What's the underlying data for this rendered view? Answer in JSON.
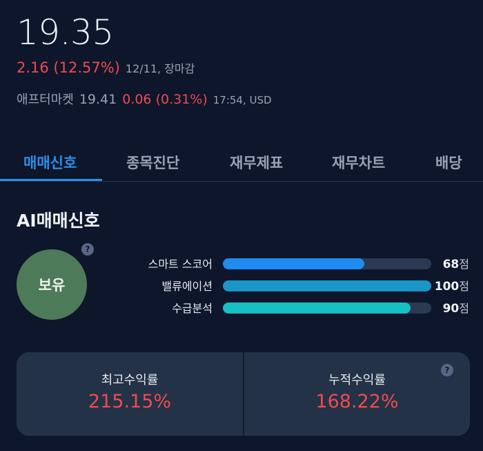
{
  "quote": {
    "price": "19.35",
    "change": "2.16 (12.57%)",
    "change_meta": "12/11, 장마감",
    "after_label": "애프터마켓",
    "after_price": "19.41",
    "after_change": "0.06 (0.31%)",
    "after_meta": "17:54, USD"
  },
  "tabs": [
    {
      "label": "매매신호",
      "active": true
    },
    {
      "label": "종목진단",
      "active": false
    },
    {
      "label": "재무제표",
      "active": false
    },
    {
      "label": "재무차트",
      "active": false
    },
    {
      "label": "배당",
      "active": false
    }
  ],
  "ai_signal": {
    "title": "AI매매신호",
    "help_glyph": "?",
    "signal": "보유",
    "signal_color": "#4d7a58",
    "scores": [
      {
        "label": "스마트 스코어",
        "value": "68",
        "unit": "점",
        "fraction": 0.68,
        "color": "#1e8cf0"
      },
      {
        "label": "밸류에이션",
        "value": "100",
        "unit": "점",
        "fraction": 1.0,
        "color": "#1a95c8"
      },
      {
        "label": "수급분석",
        "value": "90",
        "unit": "점",
        "fraction": 0.9,
        "color": "#17c0c4"
      }
    ]
  },
  "returns": {
    "help_glyph": "?",
    "max_label": "최고수익률",
    "max_value": "215.15%",
    "cum_label": "누적수익률",
    "cum_value": "168.22%"
  },
  "colors": {
    "background": "#0e162b",
    "accent": "#2e8fe8",
    "negative_red": "#f04a4f",
    "card": "#233247"
  }
}
